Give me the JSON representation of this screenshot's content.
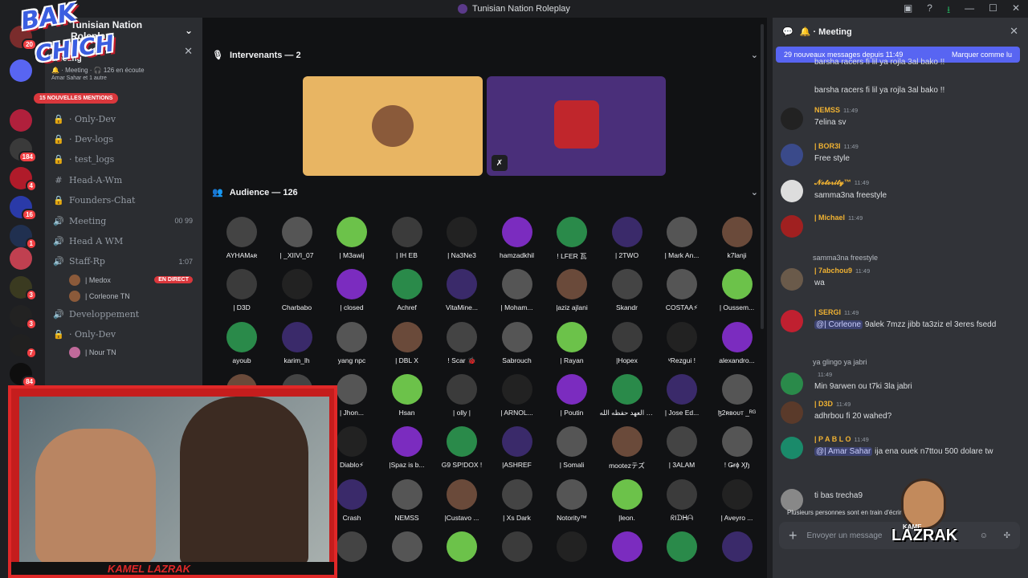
{
  "window": {
    "title": "Tunisian Nation Roleplay",
    "controls": [
      "—",
      "☐",
      "✕"
    ]
  },
  "logo_overlay": {
    "line1": "BAK",
    "line2": "CHICH"
  },
  "guilds": [
    {
      "badge": "20",
      "color": "#7a2c2c"
    },
    {
      "badge": "",
      "color": "#5865f2"
    },
    {
      "badge": "",
      "color": "#b0203c"
    },
    {
      "badge": "184",
      "color": "#3a3a3a"
    },
    {
      "badge": "4",
      "color": "#b01b2a"
    },
    {
      "badge": "16",
      "color": "#2a3aa8"
    },
    {
      "badge": "1",
      "color": "#203050"
    },
    {
      "badge": "",
      "color": "#c04050"
    },
    {
      "badge": "3",
      "color": "#3a3a20"
    },
    {
      "badge": "3",
      "color": "#222"
    },
    {
      "badge": "7",
      "color": "#202020"
    },
    {
      "badge": "84",
      "color": "#0e0e0e"
    }
  ],
  "sidebar": {
    "server_name": "Tunisian Nation Roleplay",
    "event": {
      "label": "Meeting",
      "status": "🔔 · Meeting · 🎧 126 en écoute",
      "people": "Amar Sahar et 1 autre"
    },
    "mentions_pill": "15 NOUVELLES MENTIONS",
    "channels": [
      {
        "icon": "#",
        "name": "",
        "right": ""
      },
      {
        "icon": "🔒",
        "name": "· Only-Dev",
        "right": ""
      },
      {
        "icon": "🔒",
        "name": "· Dev-logs",
        "right": ""
      },
      {
        "icon": "🔒",
        "name": "· test_logs",
        "right": ""
      },
      {
        "icon": "#",
        "name": "Head-A-Wm",
        "right": ""
      },
      {
        "icon": "🔒",
        "name": "Founders-Chat",
        "right": ""
      },
      {
        "icon": "🔊",
        "name": "Meeting",
        "right": "00 99"
      },
      {
        "icon": "🔊",
        "name": "Head A WM",
        "right": ""
      },
      {
        "icon": "🔊",
        "name": "Staff-Rp",
        "right": "1:07"
      }
    ],
    "staff_members": [
      {
        "name": "| Medox",
        "live": "EN DIRECT"
      },
      {
        "name": "| Corleone TN",
        "live": ""
      }
    ],
    "channels2": [
      {
        "icon": "🔊",
        "name": "Developpement",
        "right": ""
      },
      {
        "icon": "🔒",
        "name": "· Only-Dev",
        "right": ""
      }
    ],
    "last_member": "| Nour TN"
  },
  "main": {
    "speakers_label": "Intervenants — 2",
    "audience_label": "Audience — 126",
    "audience": [
      [
        "AYHAMᴀʀ",
        "| _XIIVI_07",
        "| M3awij",
        "| IH EB",
        "| Na3Ne3",
        "hamzadkhil",
        "! LFER 瓦",
        "| 2TWO",
        "| Mark An...",
        "k7lanji"
      ],
      [
        "| D3D",
        "Charbabo",
        "| closed",
        "Achref",
        "VitaMine...",
        "| Moham...",
        "|aziz ajlani",
        "Skandr",
        "COSTAA⚡",
        "| Oussem..."
      ],
      [
        "ayoub",
        "karim_lh",
        "yang npc",
        "| DBL X",
        "! Scar 🐞",
        "Sabrouch",
        "| Rayan",
        "|Hopex",
        "ᵛRezgui !",
        "alexandro..."
      ],
      [
        "",
        "",
        "| Jhon...",
        "Hsan",
        "| olly |",
        "| ARNOL...",
        "| Poutin",
        "ولي العهد حفظه الله",
        "| Jose Ed...",
        "ɮ2ʀʙᴏᴜᴛ _ᴿᴳ"
      ],
      [
        "",
        "",
        "Diablo⚡",
        "|Spaz is b...",
        "G9 SP!DOX !",
        "|ASHREF",
        "| Somali",
        "mootezテズ",
        "| 3ALAM",
        "! Ǥɍɸ Ӽɧ"
      ],
      [
        "",
        "",
        "Crash",
        "NEMSS",
        "|Custavo ...",
        "| Xs Dark",
        "Notority™",
        "|leon.",
        "ᖇIᗪᕼᗩ",
        "| Aveyro ..."
      ],
      [
        "",
        "",
        "",
        "",
        "",
        "",
        "",
        "",
        "",
        ""
      ]
    ],
    "audience_colors": [
      "#444",
      "#555",
      "#6cc24a",
      "#3b3b3b",
      "#222",
      "#7b2cbf",
      "#2a8a4a",
      "#3a2a6a",
      "#555",
      "#6a4a3a"
    ]
  },
  "chat": {
    "header": "🔔 · Meeting",
    "new_messages": "29 nouveaux messages depuis 11:49",
    "mark_read": "Marquer comme lu",
    "top_lines": [
      "barsha racers fi lil ya rojla 3al bako !!",
      "barsha racers fi lil ya rojla 3al bako !!"
    ],
    "messages": [
      {
        "name": "NEMSS",
        "name_color": "#f0b232",
        "time": "11:49",
        "text": "7elina sv",
        "avatar": "#222",
        "reply": "",
        "mention": ""
      },
      {
        "name": "| BOR3I",
        "name_color": "#f0b232",
        "time": "11:49",
        "text": "Free style",
        "avatar": "#3a4a8a",
        "reply": "",
        "mention": ""
      },
      {
        "name": "𝓝𝓸𝓽𝓸𝓻𝓲𝓽𝔂™",
        "name_color": "#f0b232",
        "time": "11:49",
        "text": "samma3na freestyle",
        "avatar": "#ddd",
        "reply": "",
        "mention": ""
      },
      {
        "name": "| Michael",
        "name_color": "#f0b232",
        "time": "11:49",
        "text": "",
        "avatar": "#a02020",
        "reply": "",
        "mention": ""
      },
      {
        "name": "| 7abchou9",
        "name_color": "#f0b232",
        "time": "11:49",
        "text": "wa",
        "avatar": "#6a5a4a",
        "reply": "samma3na freestyle",
        "mention": ""
      },
      {
        "name": "| SERGI",
        "name_color": "#f0b232",
        "time": "11:49",
        "text": "9alek 7mzz jibb ta3ziz el 3eres fsedd",
        "avatar": "#c02030",
        "reply": "",
        "mention": "@| Corleone"
      },
      {
        "name": "",
        "name_color": "#a06ae0",
        "time": "11:49",
        "text": "Min 9arwen ou t7ki 3la jabri",
        "avatar": "#2a8a4a",
        "reply": "ya glingo ya jabri",
        "mention": ""
      },
      {
        "name": "| D3D",
        "name_color": "#f0b232",
        "time": "11:49",
        "text": "adhrbou fi 20 wahed?",
        "avatar": "#5a3a2a",
        "reply": "",
        "mention": ""
      },
      {
        "name": "| P A B L O",
        "name_color": "#f0b232",
        "time": "11:49",
        "text": "ija ena ouek n7ttou 500 dolare tw",
        "avatar": "#1a8a6a",
        "reply": "",
        "mention": "@| Amar Sahar"
      },
      {
        "name": "",
        "name_color": "#a06ae0",
        "time": "",
        "text": "ti bas trecha9",
        "avatar": "#888",
        "reply": "",
        "mention": ""
      }
    ],
    "typing": "Plusieurs personnes sont en train d'écrire...",
    "composer_placeholder": "Envoyer un message"
  },
  "webcam": {
    "caption": "KAMEL LAZRAK"
  },
  "mascot": {
    "name": "LAZRAK",
    "small": "KAME"
  }
}
